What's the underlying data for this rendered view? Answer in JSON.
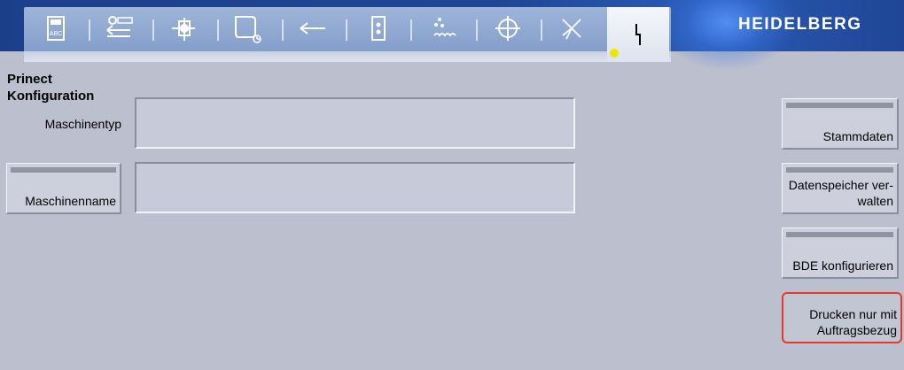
{
  "brand": {
    "logo_text": "HEIDELBERG"
  },
  "toolbar": {
    "icons": [
      "abc-document-icon",
      "feed-settings-icon",
      "sheet-transfer-icon",
      "job-sheet-icon",
      "arrow-left-icon",
      "door-icon",
      "dampening-icon",
      "register-crosshair-icon",
      "wash-spray-icon",
      "service-lightning-icon"
    ],
    "active_index": 9,
    "active_indicator_color": "#f0e600"
  },
  "page": {
    "title_line1": "Prinect",
    "title_line2": "Konfiguration"
  },
  "fields": {
    "maschinentyp_label": "Maschinentyp",
    "maschinentyp_value": "",
    "maschinenname_button": "Maschinenname",
    "maschinenname_value": ""
  },
  "side_buttons": {
    "stammdaten": "Stammdaten",
    "datenspeicher": "Datenspeicher ver-walten",
    "bde": "BDE konfigurieren",
    "drucken": "Drucken nur mit Auftragsbezug"
  },
  "colors": {
    "header_blue": "#1f4696",
    "panel_bg": "#bcbfcd",
    "highlight_red": "#e23b2a"
  }
}
